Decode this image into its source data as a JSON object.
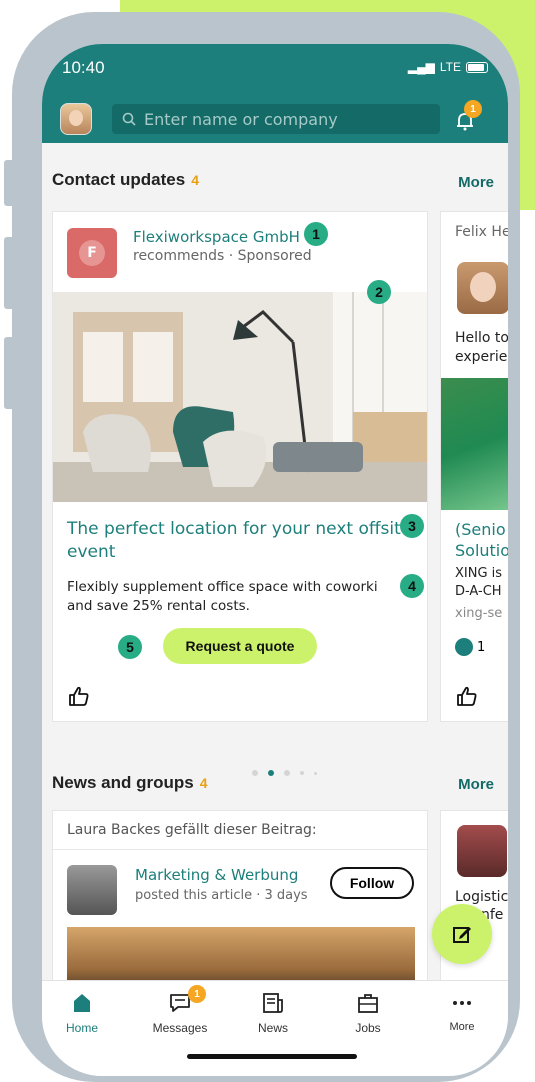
{
  "colors": {
    "brand": "#1d7f7b",
    "accent": "#ccf26b",
    "badge": "#f5a623",
    "marker": "#27ac86"
  },
  "status": {
    "time": "10:40",
    "network": "LTE"
  },
  "header": {
    "search_placeholder": "Enter name or company",
    "notification_count": "1"
  },
  "contact_updates": {
    "title": "Contact updates",
    "count": "4",
    "more": "More",
    "card": {
      "company": "Flexiworkspace GmbH",
      "subline": "recommends · Sponsored",
      "logo_letter": "F",
      "title": "The perfect location for your next offsite event",
      "desc_line1": "Flexibly supplement office space with coworki",
      "desc_line2": "and save 25% rental costs.",
      "cta": "Request a quote"
    },
    "side_card": {
      "author": "Felix He",
      "text1": "Hello to",
      "text2": "experie",
      "title1": "(Senio",
      "title2": "Solutio",
      "desc1": "XING is",
      "desc2": "D-A-CH",
      "link": "xing-se",
      "likes": "1"
    }
  },
  "markers": [
    "1",
    "2",
    "3",
    "4",
    "5"
  ],
  "news_groups": {
    "title": "News and groups",
    "count": "4",
    "more": "More",
    "card": {
      "liked_by": "Laura Backes gefällt dieser Beitrag:",
      "group": "Marketing & Werbung",
      "posted": "posted this article · 3 days",
      "follow": "Follow"
    },
    "side_card": {
      "text1": "Logistic",
      "text2": "nfe"
    }
  },
  "tabbar": {
    "items": [
      {
        "label": "Home",
        "icon": "home-icon"
      },
      {
        "label": "Messages",
        "icon": "messages-icon",
        "badge": "1"
      },
      {
        "label": "News",
        "icon": "news-icon"
      },
      {
        "label": "Jobs",
        "icon": "jobs-icon"
      },
      {
        "label": "More",
        "icon": "more-icon"
      }
    ]
  }
}
